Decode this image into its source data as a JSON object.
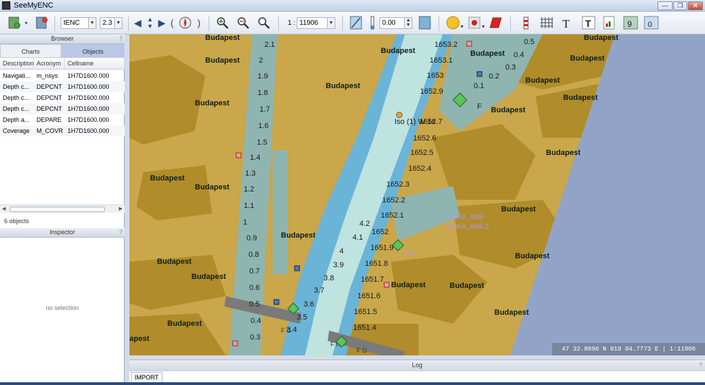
{
  "window": {
    "title": "SeeMyENC"
  },
  "toolbar": {
    "chart_type": "IENC",
    "version": "2.3",
    "scale_prefix": "1 :",
    "scale": "11906",
    "rotation": "0.00"
  },
  "browser": {
    "title": "Browser",
    "help": "?",
    "tabs": [
      {
        "label": "Charts"
      },
      {
        "label": "Objects"
      }
    ],
    "columns": [
      "Description",
      "Acronym",
      "Cellname"
    ],
    "rows": [
      {
        "description": "Navigati...",
        "acronym": "m_nsys",
        "cellname": "1H7D1600.000"
      },
      {
        "description": "Depth c...",
        "acronym": "DEPCNT",
        "cellname": "1H7D1600.000"
      },
      {
        "description": "Depth c...",
        "acronym": "DEPCNT",
        "cellname": "1H7D1600.000"
      },
      {
        "description": "Depth c...",
        "acronym": "DEPCNT",
        "cellname": "1H7D1600.000"
      },
      {
        "description": "Depth a...",
        "acronym": "DEPARE",
        "cellname": "1H7D1600.000"
      },
      {
        "description": "Coverage",
        "acronym": "M_COVR",
        "cellname": "1H7D1600.000"
      }
    ],
    "count": "6 objects"
  },
  "inspector": {
    "title": "Inspector",
    "help": "?",
    "empty": "no selection"
  },
  "map": {
    "place_name": "Budapest",
    "place_name_clipped": "apest",
    "kilometres": [
      "1653.2",
      "1653.1",
      "1653",
      "1652.9",
      "1652.7",
      "1652.6",
      "1652.5",
      "1652.4",
      "1652.3",
      "1652.2",
      "1652.1",
      "1652",
      "1651.9",
      "1651.8",
      "1651.7",
      "1651.6",
      "1651.5",
      "1651.4"
    ],
    "left_depths": [
      "2.1",
      "2",
      "1.9",
      "1.8",
      "1.7",
      "1.6",
      "1.5",
      "1.4",
      "1.3",
      "1.2",
      "1.1",
      "1",
      "0.9",
      "0.8",
      "0.7",
      "0.6",
      "0.5",
      "0.4",
      "0.3"
    ],
    "right_depths": [
      "0.5",
      "0.4",
      "0.3",
      "0.2",
      "0.1"
    ],
    "channel_depths": [
      "4.2",
      "4.1",
      "4",
      "3.9",
      "3.8",
      "3.7",
      "3.6",
      "3.5",
      "3.4"
    ],
    "light_label": "Iso (1) W 1s",
    "light_label_2": "F",
    "buoy_labels": [
      "F G",
      "F R",
      "F G",
      "1652",
      "2.2"
    ],
    "bay_labels": [
      "FOKA_öböl",
      "FOKA_öböl 2"
    ],
    "colors": {
      "land": "#c9a74a",
      "land_dark": "#b08c2a",
      "shallow": "#8fb5b0",
      "water": "#6ab4d8",
      "deep": "#bfe3de",
      "mask": "#91a4c8"
    }
  },
  "status": {
    "coordinates": "47 32.8096 N   019 04.7773 E | 1:11906"
  },
  "log": {
    "title": "Log",
    "help": "?",
    "tabs": [
      {
        "label": "IMPORT"
      }
    ]
  }
}
